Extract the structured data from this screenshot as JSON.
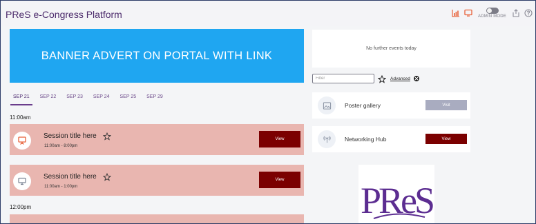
{
  "app": {
    "title": "PReS e-Congress Platform"
  },
  "topbar": {
    "icons": [
      "bar-chart-icon",
      "monitor-icon",
      "export-icon",
      "help-icon"
    ],
    "admin_mode_label": "ADMIN MODE",
    "accent": "#e8623a"
  },
  "banner": {
    "text": "BANNER ADVERT ON PORTAL WITH LINK",
    "color": "#1fa6f1"
  },
  "date_tabs": [
    {
      "label": "SEP 21",
      "active": true
    },
    {
      "label": "SEP 22"
    },
    {
      "label": "SEP 23"
    },
    {
      "label": "SEP 24"
    },
    {
      "label": "SEP 25"
    },
    {
      "label": "SEP 29"
    }
  ],
  "schedule": {
    "time_slots": [
      "11:00am",
      "12:00pm"
    ],
    "sessions": [
      {
        "title": "Session title here",
        "time": "11:00am - 8:00pm",
        "button": "View",
        "icon": "presentation-icon",
        "icon_color": "#e8623a"
      },
      {
        "title": "Session title here",
        "time": "11:00am - 1:00pm",
        "button": "View",
        "icon": "monitor-icon",
        "icon_color": "#7a8494"
      }
    ]
  },
  "sidebar": {
    "no_events": "No further events today",
    "filter_placeholder": "Filter",
    "advanced_label": "Advanced",
    "features": [
      {
        "title": "Poster gallery",
        "button": "Visit",
        "button_color": "#a9acc0",
        "icon": "image-icon"
      },
      {
        "title": "Networking Hub",
        "button": "View",
        "button_color": "#7b0000",
        "icon": "networking-icon"
      }
    ]
  },
  "logo": {
    "text": "PReS",
    "color": "#5c2d91"
  },
  "colors": {
    "session_bg": "#e9b6b0",
    "view_button": "#7b0000",
    "brand_purple": "#4b2a6b"
  }
}
